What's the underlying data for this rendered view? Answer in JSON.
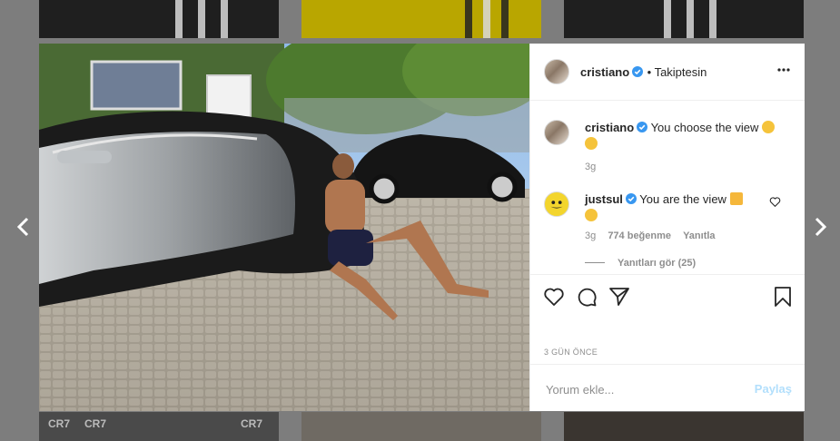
{
  "post": {
    "author": "cristiano",
    "follow_status": "• Takiptesin",
    "date_label": "3 GÜN ÖNCE",
    "actions": {
      "like_icon": "heart-icon",
      "comment_icon": "comment-icon",
      "share_icon": "send-icon",
      "save_icon": "bookmark-icon"
    }
  },
  "comments": [
    {
      "user": "cristiano",
      "text": "You choose the view",
      "time": "3g"
    },
    {
      "user": "justsul",
      "text": "You are the view",
      "time": "3g",
      "likes": "774 beğenme",
      "reply": "Yanıtla",
      "view_replies": "Yanıtları gör (25)"
    }
  ],
  "comment_box": {
    "placeholder": "Yorum ekle...",
    "share_label": "Paylaş"
  },
  "background_tiles": {
    "cr7_label": "CR7"
  },
  "colors": {
    "verified": "#3897f0",
    "link_disabled": "#b2dffc",
    "overlay": "#7d7d7d"
  }
}
